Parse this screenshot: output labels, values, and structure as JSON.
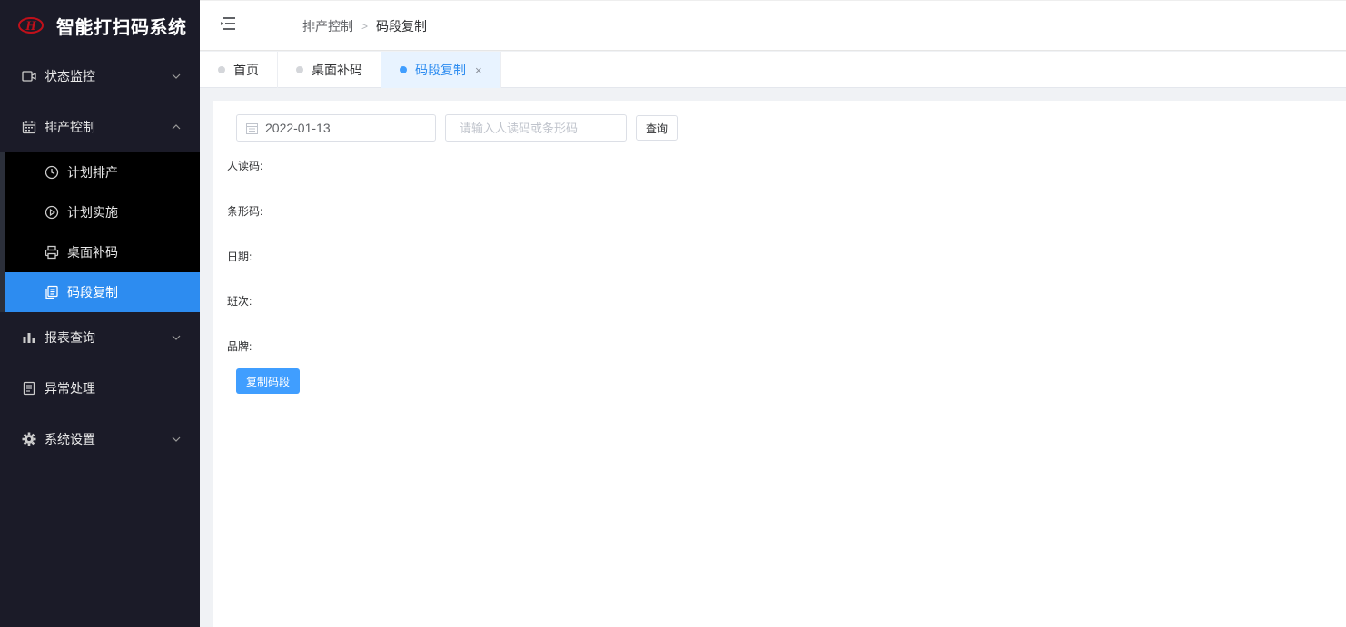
{
  "app": {
    "title": "智能打扫码系统",
    "logo_icon": "brand-logo-icon"
  },
  "sidebar": {
    "items": [
      {
        "label": "状态监控",
        "icon": "video-camera-icon",
        "expanded": false
      },
      {
        "label": "排产控制",
        "icon": "calendar-icon",
        "expanded": true,
        "children": [
          {
            "label": "计划排产",
            "icon": "clock-icon"
          },
          {
            "label": "计划实施",
            "icon": "play-circle-icon"
          },
          {
            "label": "桌面补码",
            "icon": "printer-icon"
          },
          {
            "label": "码段复制",
            "icon": "copy-document-icon",
            "active": true
          }
        ]
      },
      {
        "label": "报表查询",
        "icon": "bar-chart-icon",
        "expanded": false
      },
      {
        "label": "异常处理",
        "icon": "document-icon"
      },
      {
        "label": "系统设置",
        "icon": "gear-icon",
        "expanded": false
      }
    ]
  },
  "header": {
    "breadcrumb": [
      "排产控制",
      "码段复制"
    ],
    "breadcrumb_sep": ">"
  },
  "tabs": [
    {
      "label": "首页",
      "active": false
    },
    {
      "label": "桌面补码",
      "active": false
    },
    {
      "label": "码段复制",
      "active": true,
      "closable": true,
      "close_glyph": "×"
    }
  ],
  "search": {
    "date_value": "2022-01-13",
    "code_placeholder": "请输入人读码或条形码",
    "query_label": "查询"
  },
  "fields": {
    "human_code": "人读码:",
    "barcode": "条形码:",
    "date": "日期:",
    "shift": "班次:",
    "brand": "品牌:"
  },
  "actions": {
    "copy_label": "复制码段"
  },
  "colors": {
    "sidebar_bg": "#1b1b28",
    "accent": "#409eff",
    "active_menu": "#2d8cf0"
  }
}
